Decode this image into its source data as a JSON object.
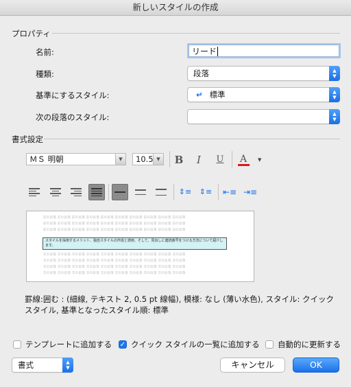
{
  "window": {
    "title": "新しいスタイルの作成"
  },
  "properties": {
    "section_label": "プロパティ",
    "name_label": "名前:",
    "name_value": "リード",
    "type_label": "種類:",
    "type_value": "段落",
    "base_label": "基準にするスタイル:",
    "base_value": "標準",
    "base_icon": "paragraph-return-icon",
    "next_label": "次の段落のスタイル:",
    "next_value": ""
  },
  "formatting": {
    "section_label": "書式設定",
    "font_name": "ＭＳ 明朝",
    "font_size": "10.5",
    "bold": "B",
    "italic": "I",
    "underline": "U",
    "font_color_letter": "A",
    "font_color": "#e0161b",
    "selected_alignment": "justify",
    "selected_spacing": "single"
  },
  "preview": {
    "ghost_text": "前の段落 前の段落 前の段落 前の段落 前の段落 前の段落 前の段落 前の段落 前の段落 前の段落",
    "sample_text": "スタイルを採用するメリット、独自スタイルの作成と適用、そして、見出しに連続番号をつける方法について紹介します。",
    "after_text": "次の段落 次の段落 次の段落 次の段落 次の段落 次の段落 次の段落 次の段落 次の段落 次の段落"
  },
  "description": "罫線:囲む : (細線, テキスト 2,  0.5 pt 線幅), 模様: なし (薄い水色), スタイル: クイック スタイル, 基準となったスタイル順: 標準",
  "options": {
    "add_template": "テンプレートに追加する",
    "add_template_checked": false,
    "quick_style": "クイック スタイルの一覧に追加する",
    "quick_style_checked": true,
    "auto_update": "自動的に更新する",
    "auto_update_checked": false
  },
  "footer": {
    "format_menu": "書式",
    "cancel": "キャンセル",
    "ok": "OK"
  },
  "colors": {
    "accent": "#1a70ea",
    "preview_fill": "#d4f1f4"
  }
}
